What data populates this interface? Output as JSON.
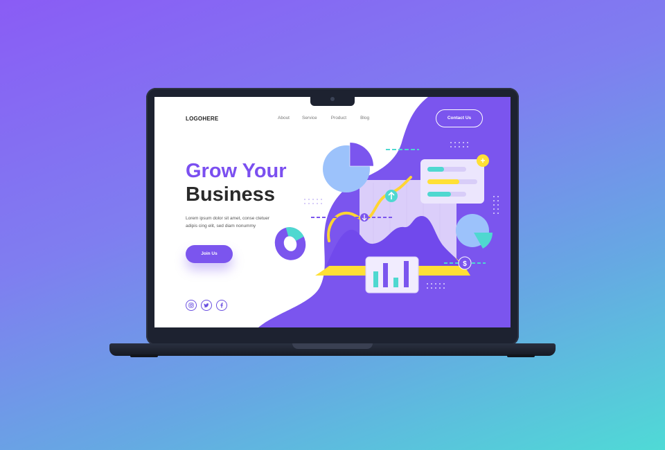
{
  "nav": {
    "logo": "LOGOHERE",
    "links": [
      "About",
      "Service",
      "Product",
      "Blog"
    ],
    "contact_label": "Contact Us"
  },
  "hero": {
    "title_line1": "Grow Your",
    "title_line2": "Business",
    "description_line1": "Lorem ipsum dolor sit amet, conse ctetuer",
    "description_line2": "adipis cing elit, sed diam nonummy",
    "cta_label": "Join Us"
  },
  "socials": [
    {
      "name": "instagram-icon"
    },
    {
      "name": "twitter-icon"
    },
    {
      "name": "facebook-icon"
    }
  ],
  "colors": {
    "purple": "#7b55ee",
    "yellow": "#ffe036",
    "teal": "#4fd8d0",
    "light_blue": "#9cc2fb",
    "lavender": "#e7dcfb"
  },
  "illustration": {
    "dollar_symbol": "$",
    "plus_symbol": "+"
  }
}
